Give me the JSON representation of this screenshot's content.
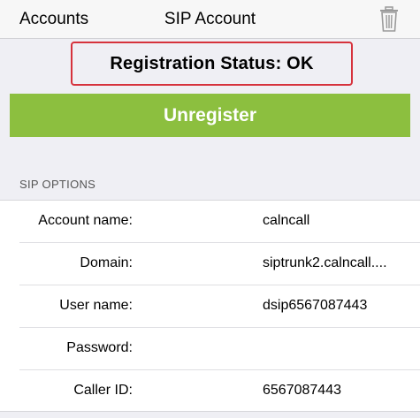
{
  "navbar": {
    "back_label": "Accounts",
    "title": "SIP Account",
    "delete_icon": "trash-icon"
  },
  "status": {
    "text": "Registration Status: OK",
    "highlight_color": "#d6323c"
  },
  "unregister_button": {
    "label": "Unregister",
    "color": "#8cbf3f"
  },
  "sip_options": {
    "header": "SIP OPTIONS",
    "rows": [
      {
        "label": "Account name:",
        "value": "calncall"
      },
      {
        "label": "Domain:",
        "value": "siptrunk2.calncall...."
      },
      {
        "label": "User name:",
        "value": "dsip6567087443"
      },
      {
        "label": "Password:",
        "value": ""
      },
      {
        "label": "Caller ID:",
        "value": "6567087443"
      }
    ]
  }
}
